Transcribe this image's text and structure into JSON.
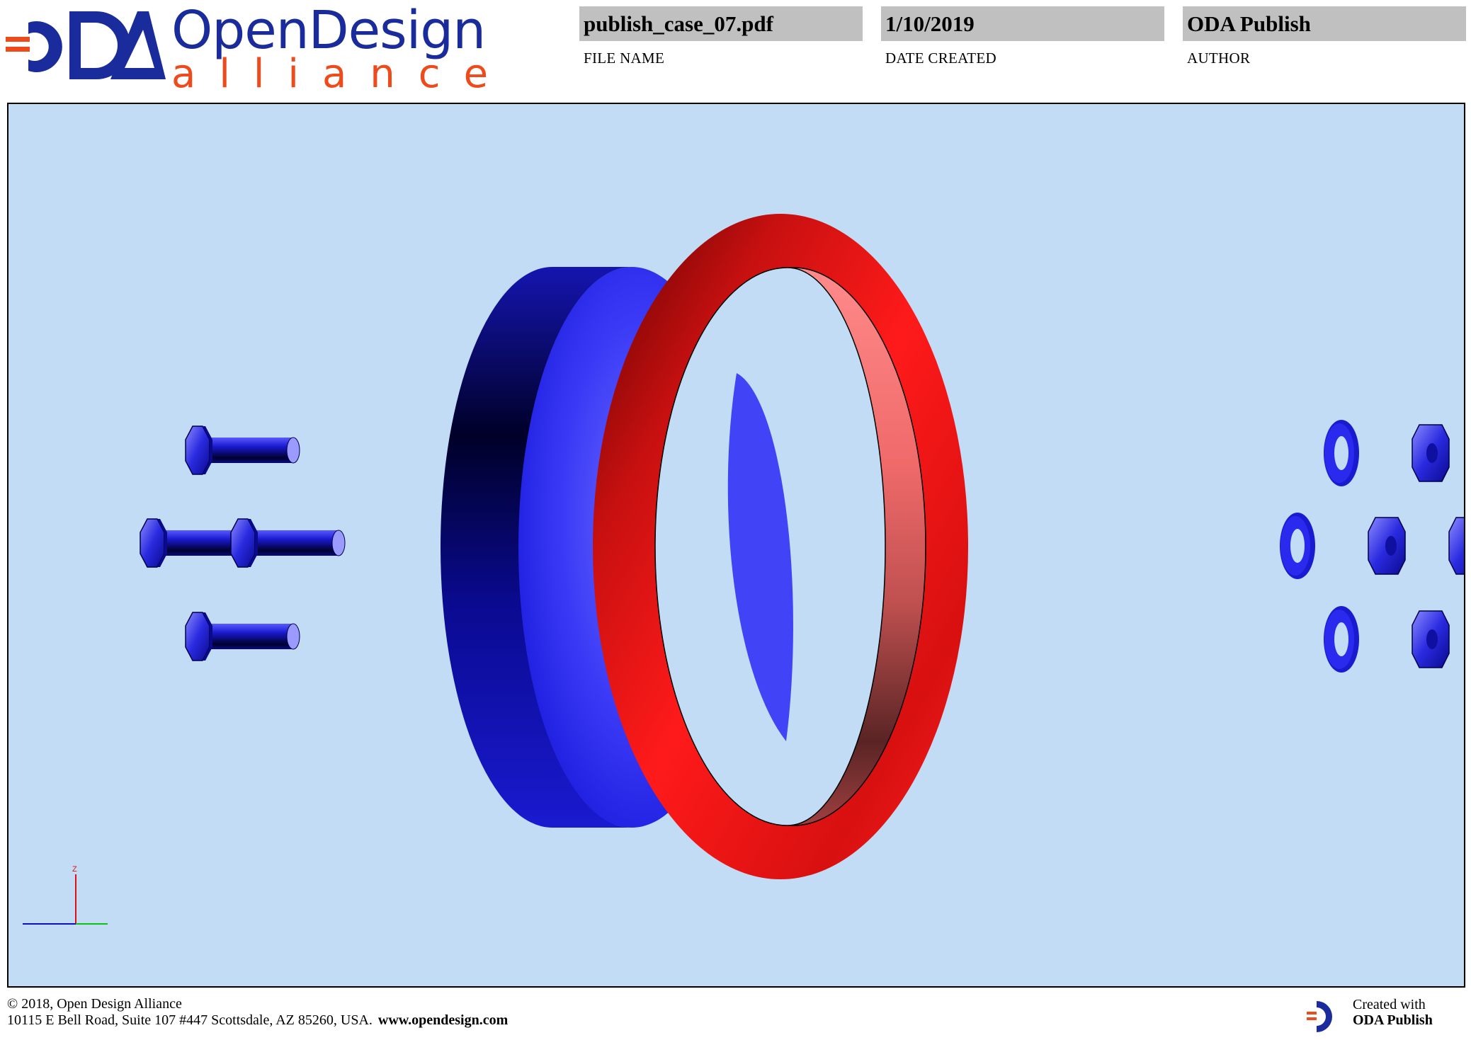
{
  "header": {
    "logo": {
      "mark": "ODA",
      "word_top": "OpenDesign",
      "word_bottom": "alliance",
      "brand_blue": "#1a2c9b",
      "brand_orange": "#ee4b1c",
      "icon": "oda-logo-icon"
    },
    "fields": [
      {
        "value": "publish_case_07.pdf",
        "label": "FILE NAME"
      },
      {
        "value": "1/10/2019",
        "label": "DATE CREATED"
      },
      {
        "value": "ODA Publish",
        "label": "AUTHOR"
      }
    ]
  },
  "viewport": {
    "background": "#c2dcf6",
    "axis_label": "Z",
    "parts": {
      "bolts": 4,
      "washers": 3,
      "nuts": 4,
      "disc_color": "#1a1ad8",
      "ring_color": "#ee1111"
    }
  },
  "footer": {
    "copyright": "©  2018, Open Design Alliance",
    "address": "10115 E Bell Road, Suite 107 #447 Scottsdale, AZ 85260, USA.",
    "website": "www.opendesign.com",
    "created_with": "Created with",
    "product": "ODA Publish"
  }
}
